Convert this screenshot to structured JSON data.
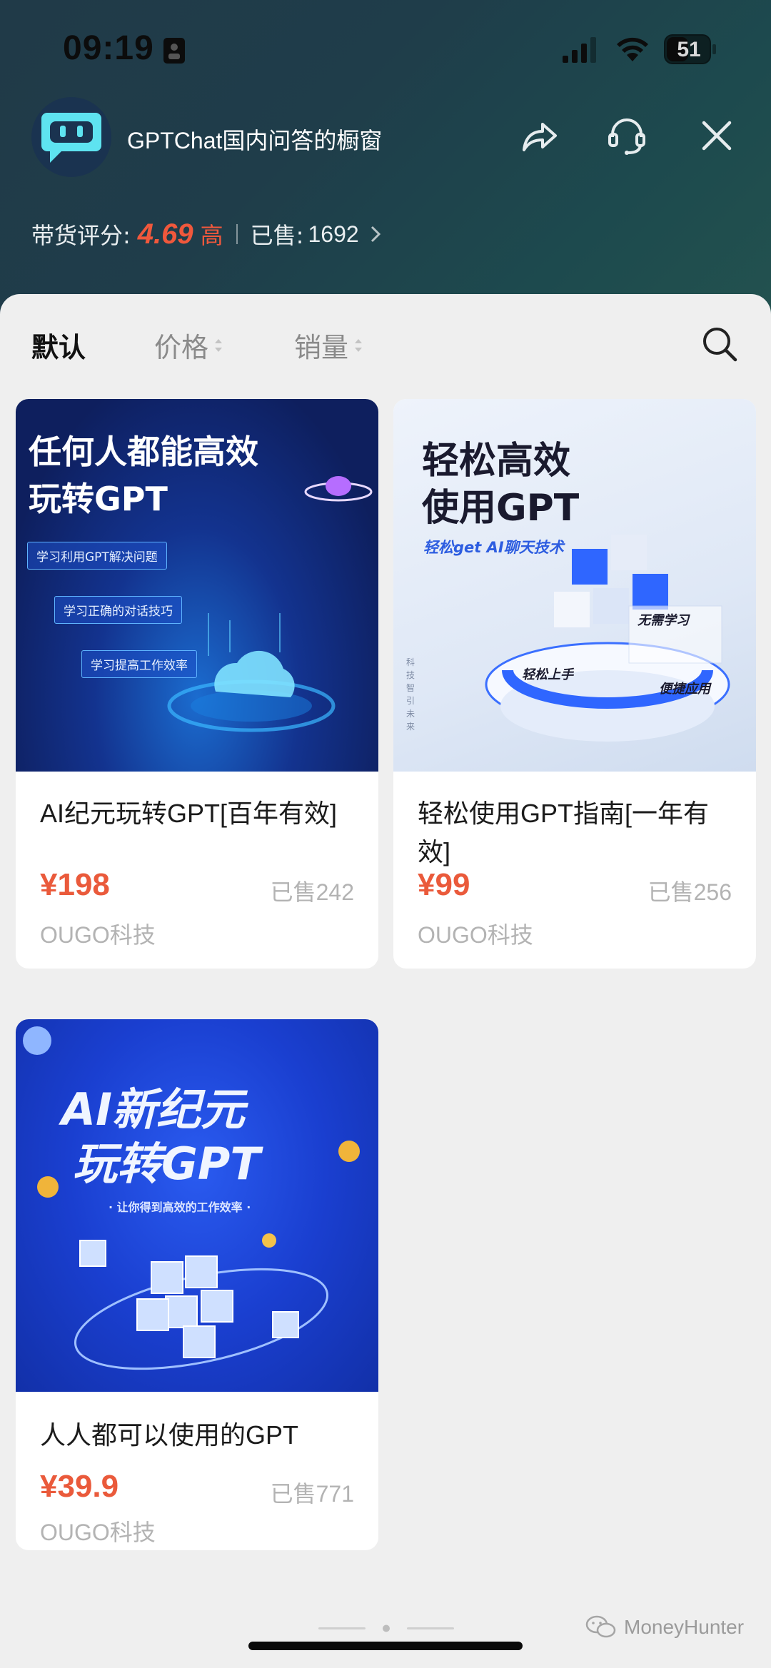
{
  "status_bar": {
    "time": "09:19",
    "battery_level": "51"
  },
  "header": {
    "shop_name": "GPTChat国内问答的橱窗",
    "rating_label": "带货评分:",
    "rating_score": "4.69",
    "rating_level": "高",
    "sold_label": "已售:",
    "sold_count": "1692"
  },
  "sort_bar": {
    "tabs": [
      {
        "label": "默认",
        "active": true
      },
      {
        "label": "价格",
        "active": false
      },
      {
        "label": "销量",
        "active": false
      }
    ]
  },
  "products": [
    {
      "title": "AI纪元玩转GPT[百年有效]",
      "price": "¥198",
      "sold": "已售242",
      "shop": "OUGO科技",
      "image": {
        "headline_1": "任何人都能高效",
        "headline_2": "玩转GPT",
        "chips": [
          "学习利用GPT解决问题",
          "学习正确的对话技巧",
          "学习提高工作效率"
        ]
      }
    },
    {
      "title": "轻松使用GPT指南[一年有效]",
      "price": "¥99",
      "sold": "已售256",
      "shop": "OUGO科技",
      "image": {
        "headline_1": "轻松高效",
        "headline_2": "使用GPT",
        "subline": "轻松get AI聊天技术",
        "tag_1": "无需学习",
        "tag_2": "轻松上手",
        "tag_3": "便捷应用",
        "vertical": "科技智引未来"
      }
    },
    {
      "title": "人人都可以使用的GPT",
      "price": "¥39.9",
      "sold": "已售771",
      "shop": "OUGO科技",
      "image": {
        "headline_1": "AI新纪元",
        "headline_2": "玩转GPT",
        "subline": "· 让你得到高效的工作效率 ·"
      }
    }
  ],
  "watermark": "MoneyHunter",
  "colors": {
    "accent": "#ea5a3b",
    "header_bg": "#1f3d4a",
    "panel_bg": "#efefef"
  }
}
